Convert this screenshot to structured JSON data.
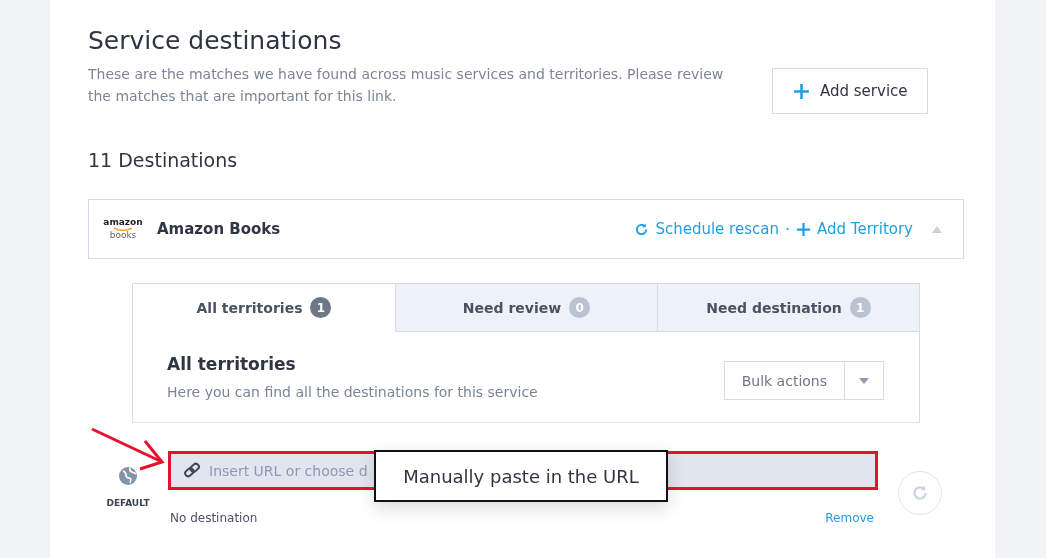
{
  "header": {
    "title": "Service destinations",
    "description": "These are the matches we have found across music services and territories. Please review the matches that are important for this link.",
    "add_button": "Add service"
  },
  "destinations_count": "11 Destinations",
  "service": {
    "name": "Amazon Books",
    "logo_top": "amazon",
    "logo_bottom": "books",
    "actions": [
      {
        "label": "Schedule rescan",
        "kind": "rescan"
      },
      {
        "label": "Add Territory",
        "kind": "add"
      }
    ],
    "separator": "·",
    "expanded": true
  },
  "tabs": [
    {
      "label": "All territories",
      "count": "1",
      "selected": true
    },
    {
      "label": "Need review",
      "count": "0",
      "selected": false
    },
    {
      "label": "Need destination",
      "count": "1",
      "selected": false
    }
  ],
  "section": {
    "title": "All territories",
    "description": "Here you can find all the destinations for this service",
    "bulk_button": "Bulk actions"
  },
  "territory": {
    "label": "DEFAULT",
    "url_placeholder": "Insert URL or choose d",
    "status": "No destination",
    "remove": "Remove"
  },
  "annotation": {
    "callout": "Manually paste in the URL"
  }
}
